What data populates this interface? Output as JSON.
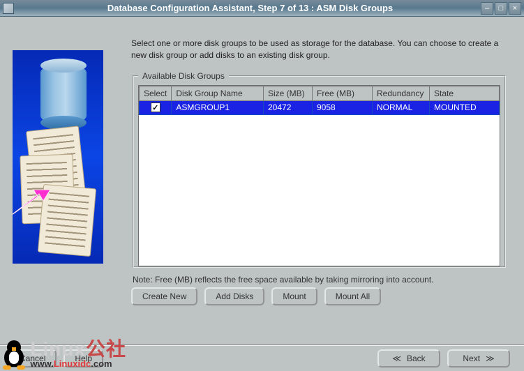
{
  "window": {
    "title": "Database Configuration Assistant, Step 7 of 13 : ASM Disk Groups"
  },
  "intro": "Select one or more disk groups to be used as storage for the database. You can choose to create a new disk group or add disks to an existing disk group.",
  "group_box_title": "Available Disk Groups",
  "columns": {
    "select": "Select",
    "name": "Disk Group Name",
    "size": "Size (MB)",
    "free": "Free (MB)",
    "redundancy": "Redundancy",
    "state": "State"
  },
  "rows": [
    {
      "selected": true,
      "name": "ASMGROUP1",
      "size": "20472",
      "free": "9058",
      "redundancy": "NORMAL",
      "state": "MOUNTED"
    }
  ],
  "note": "Note: Free (MB) reflects the free space available by taking mirroring into account.",
  "buttons": {
    "create_new": "Create New",
    "add_disks": "Add Disks",
    "mount": "Mount",
    "mount_all": "Mount All",
    "cancel": "Cancel",
    "help": "Help",
    "back": "Back",
    "next": "Next"
  },
  "nav_icons": {
    "back": "≪",
    "next": "≫"
  },
  "watermark": {
    "line1_a": "Linux",
    "line1_b": "公社",
    "line2_a": "www.",
    "line2_b": "Linuxidc",
    "line2_c": ".com"
  }
}
